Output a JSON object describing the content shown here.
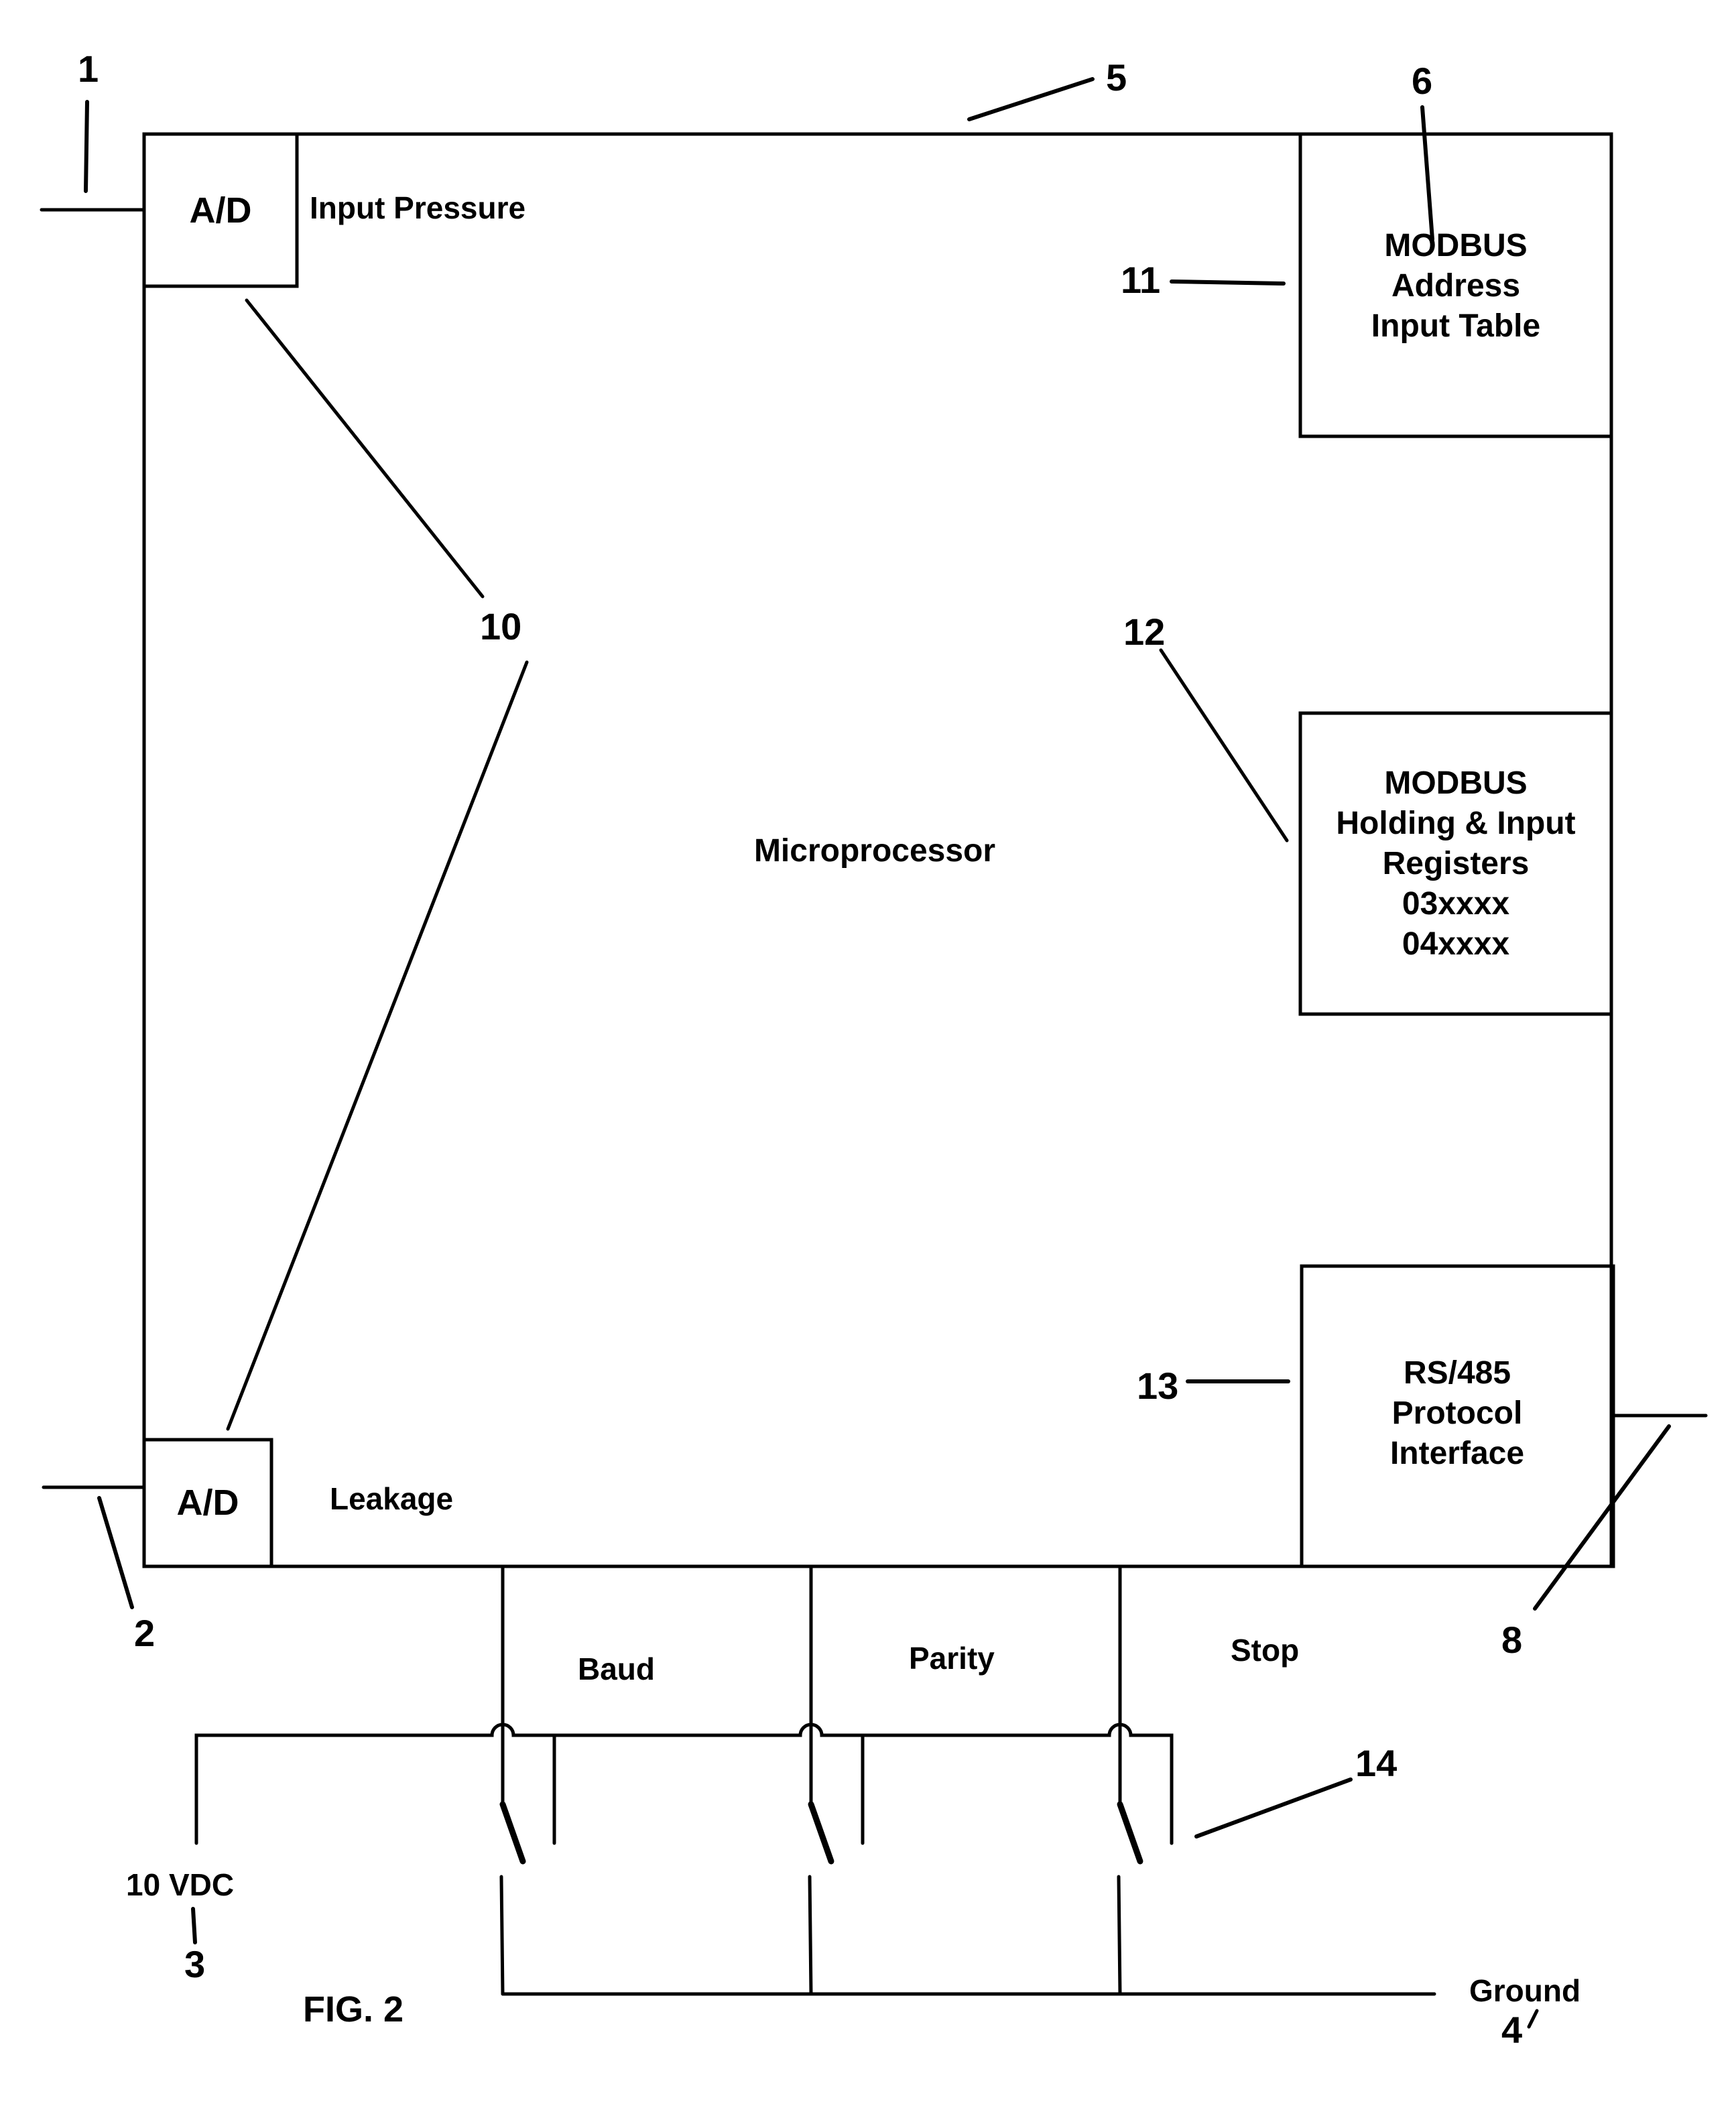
{
  "figure": {
    "caption": "FIG. 2",
    "ink_color": "#000000",
    "background_color": "#ffffff"
  },
  "main_block": {
    "label": "Microprocessor",
    "ref": "5"
  },
  "ad_converters": [
    {
      "label": "A/D",
      "signal_label": "Input Pressure",
      "input_ref": "1"
    },
    {
      "label": "A/D",
      "signal_label": "Leakage",
      "input_ref": "2"
    }
  ],
  "ad_group_ref": "10",
  "right_blocks": [
    {
      "ref": "11",
      "lines": [
        "MODBUS",
        "Address",
        "Input Table"
      ],
      "pointer_ref": "6"
    },
    {
      "ref": "12",
      "lines": [
        "MODBUS",
        "Holding & Input",
        "Registers",
        "03xxxx",
        "04xxxx"
      ]
    },
    {
      "ref": "13",
      "lines": [
        "RS/485",
        "Protocol",
        "Interface"
      ],
      "output_ref": "8"
    }
  ],
  "dip_switches": {
    "ref": "14",
    "labels": [
      "Baud",
      "Parity",
      "Stop"
    ]
  },
  "power": {
    "label": "10 VDC",
    "ref": "3"
  },
  "ground": {
    "label": "Ground",
    "ref": "4"
  }
}
